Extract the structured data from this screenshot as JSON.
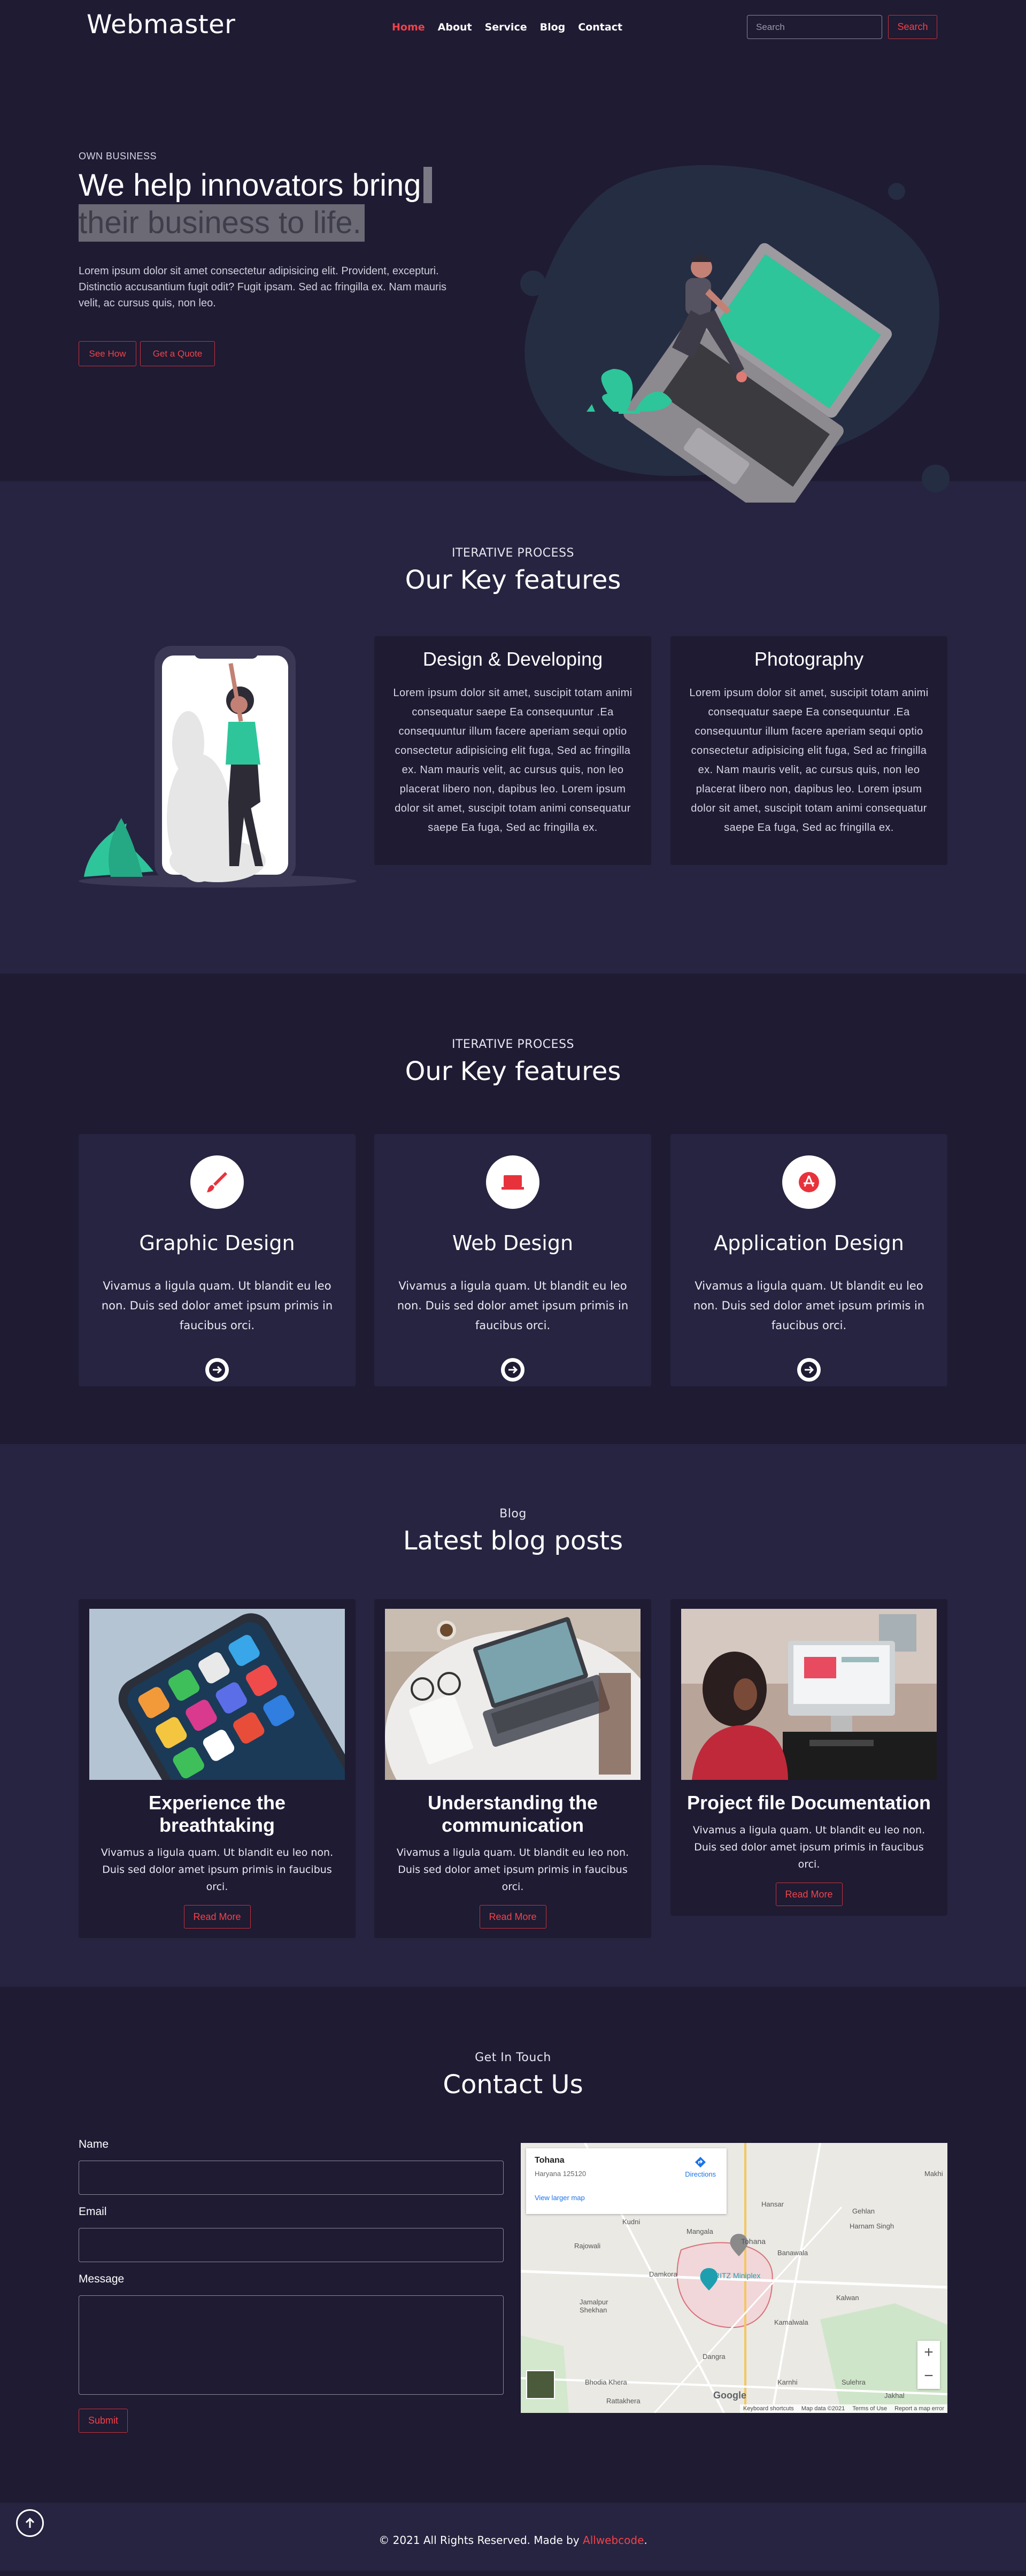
{
  "nav": {
    "logo": "Webmaster",
    "items": [
      "Home",
      "About",
      "Service",
      "Blog",
      "Contact"
    ],
    "search_placeholder": "Search",
    "search_button": "Search"
  },
  "hero": {
    "eyebrow": "OWN BUSINESS",
    "title_line1": "We help innovators bring",
    "title_line2": "their business to life.",
    "text": "Lorem ipsum dolor sit amet consectetur adipisicing elit. Provident, excepturi. Distinctio accusantium fugit odit? Fugit ipsam. Sed ac fringilla ex. Nam mauris velit, ac cursus quis, non leo.",
    "btn_primary": "See How",
    "btn_secondary": "Get a Quote"
  },
  "features": {
    "small": "ITERATIVE PROCESS",
    "big": "Our Key features",
    "cards": [
      {
        "title": "Design & Developing",
        "text": "Lorem ipsum dolor sit amet, suscipit totam animi consequatur saepe Ea consequuntur .Ea consequuntur illum facere aperiam sequi optio consectetur adipisicing elit fuga, Sed ac fringilla ex. Nam mauris velit, ac cursus quis, non leo placerat libero non, dapibus leo. Lorem ipsum dolor sit amet, suscipit totam animi consequatur saepe Ea fuga, Sed ac fringilla ex."
      },
      {
        "title": "Photography",
        "text": "Lorem ipsum dolor sit amet, suscipit totam animi consequatur saepe Ea consequuntur .Ea consequuntur illum facere aperiam sequi optio consectetur adipisicing elit fuga, Sed ac fringilla ex. Nam mauris velit, ac cursus quis, non leo placerat libero non, dapibus leo. Lorem ipsum dolor sit amet, suscipit totam animi consequatur saepe Ea fuga, Sed ac fringilla ex."
      }
    ]
  },
  "services": {
    "small": "ITERATIVE PROCESS",
    "big": "Our Key features",
    "cards": [
      {
        "icon": "paintbrush-icon",
        "title": "Graphic Design",
        "text": "Vivamus a ligula quam. Ut blandit eu leo non. Duis sed dolor amet ipsum primis in faucibus orci."
      },
      {
        "icon": "laptop-icon",
        "title": "Web Design",
        "text": "Vivamus a ligula quam. Ut blandit eu leo non. Duis sed dolor amet ipsum primis in faucibus orci."
      },
      {
        "icon": "app-store-icon",
        "title": "Application Design",
        "text": "Vivamus a ligula quam. Ut blandit eu leo non. Duis sed dolor amet ipsum primis in faucibus orci."
      }
    ]
  },
  "blog": {
    "small": "Blog",
    "big": "Latest blog posts",
    "posts": [
      {
        "title": "Experience the breathtaking",
        "text": "Vivamus a ligula quam. Ut blandit eu leo non. Duis sed dolor amet ipsum primis in faucibus orci.",
        "button": "Read More"
      },
      {
        "title": "Understanding the communication",
        "text": "Vivamus a ligula quam. Ut blandit eu leo non. Duis sed dolor amet ipsum primis in faucibus orci.",
        "button": "Read More"
      },
      {
        "title": "Project file Documentation",
        "text": "Vivamus a ligula quam. Ut blandit eu leo non. Duis sed dolor amet ipsum primis in faucibus orci.",
        "button": "Read More"
      }
    ]
  },
  "contact": {
    "small": "Get In Touch",
    "big": "Contact Us",
    "name_label": "Name",
    "email_label": "Email",
    "message_label": "Message",
    "submit": "Submit",
    "map": {
      "place": "Tohana",
      "address": "Haryana 125120",
      "directions": "Directions",
      "larger_map": "View larger map",
      "pin_label": "Tohana",
      "poi_label": "RITZ Miniplex",
      "towns": [
        "Mangala",
        "Kudni",
        "Rajowali",
        "Damkora",
        "Jamalpur Shekhan",
        "Bhodia Khera",
        "Rattakhera",
        "Dangra",
        "Karnhi",
        "Kalwan",
        "Kamalwala",
        "Sulehra",
        "Jakhal",
        "Banawala",
        "Hansar",
        "Makhi",
        "Gehlan",
        "Harnam Singh"
      ],
      "footer_items": [
        "Keyboard shortcuts",
        "Map data ©2021",
        "Terms of Use",
        "Report a map error"
      ],
      "google": "Google"
    }
  },
  "footer": {
    "text": "© 2021 All Rights Reserved. Made by ",
    "brand": "Allwebcode",
    "period": "."
  },
  "colors": {
    "accent": "#f1424a",
    "background": "#1e1b33",
    "section_alt": "#262440",
    "card": "#262440",
    "illustration_green": "#2ec59a"
  }
}
